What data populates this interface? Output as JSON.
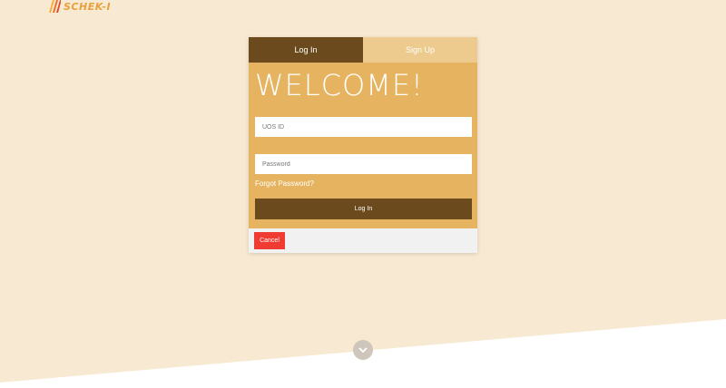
{
  "brand": {
    "logo_text": "SCHEK-I"
  },
  "tabs": {
    "login": "Log In",
    "signup": "Sign Up"
  },
  "form": {
    "welcome": "WELCOME!",
    "uos_placeholder": "UOS ID",
    "password_placeholder": "Password",
    "forgot_label": "Forgot Password?",
    "login_button": "Log In"
  },
  "footer": {
    "cancel_button": "Cancel"
  },
  "colors": {
    "page_bg": "#f8e9d2",
    "card_bg": "#e6b460",
    "dark_brown": "#6b4a1e",
    "light_tab": "#edca8e",
    "cancel_red": "#ef3b32"
  },
  "icons": {
    "scroll": "chevron-down-icon",
    "logo": "logo-stripes-icon"
  }
}
